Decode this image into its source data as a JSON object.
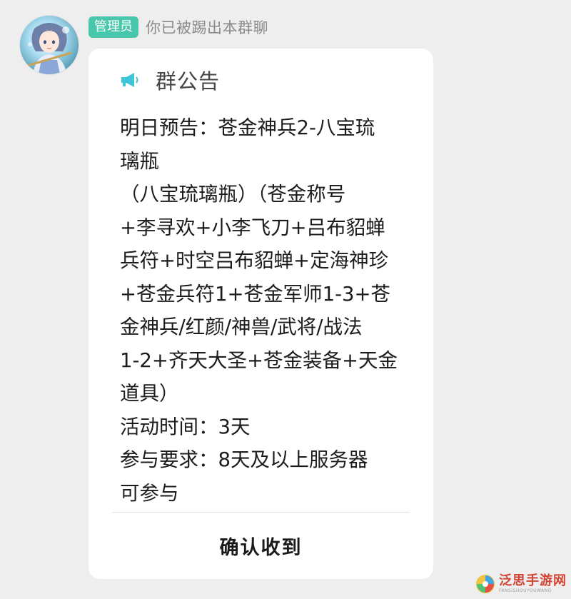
{
  "sender": {
    "role_badge": "管理员",
    "name": "你已被踢出本群聊",
    "avatar_icon": "anime-character-avatar"
  },
  "notice": {
    "icon": "megaphone-icon",
    "title": "群公告",
    "lines": [
      "明日预告：苍金神兵2-八宝琉",
      "璃瓶",
      "（八宝琉璃瓶）（苍金称号",
      "+李寻欢+小李飞刀+吕布貂蝉",
      "兵符+时空吕布貂蝉+定海神珍",
      "+苍金兵符1+苍金军师1-3+苍",
      "金神兵/红颜/神兽/武将/战法",
      "1-2+齐天大圣+苍金装备+天金",
      "道具）",
      "活动时间：3天",
      "参与要求：8天及以上服务器",
      "可参与"
    ],
    "confirm_label": "确认收到"
  },
  "watermark": {
    "text": "泛思手游网",
    "subtext": "FANSISHOUYOUWANG"
  },
  "colors": {
    "badge": "#49c7ac",
    "background": "#eeeeee",
    "card": "#ffffff",
    "icon": "#3ec6d6"
  }
}
